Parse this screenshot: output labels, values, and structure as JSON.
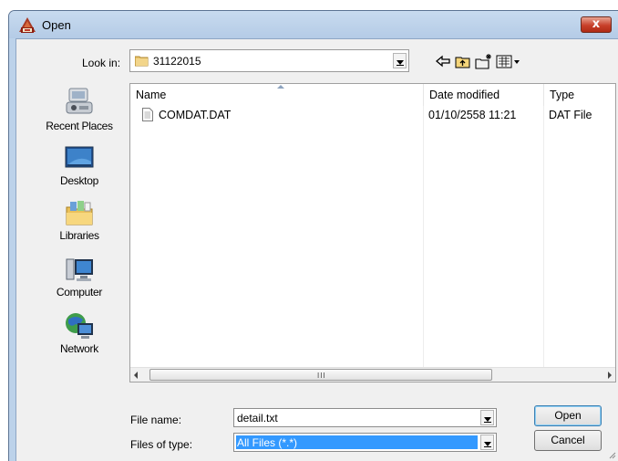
{
  "window": {
    "title": "Open",
    "close_label": "x"
  },
  "lookin": {
    "label": "Look in:",
    "value": "31122015"
  },
  "toolbar": {
    "back_icon": "back-arrow-icon",
    "up_icon": "up-folder-icon",
    "new_folder_icon": "new-folder-icon",
    "view_icon": "view-menu-icon"
  },
  "places": [
    {
      "label": "Recent Places",
      "icon": "recent-places-icon"
    },
    {
      "label": "Desktop",
      "icon": "desktop-icon"
    },
    {
      "label": "Libraries",
      "icon": "libraries-icon"
    },
    {
      "label": "Computer",
      "icon": "computer-icon"
    },
    {
      "label": "Network",
      "icon": "network-icon"
    }
  ],
  "filelist": {
    "columns": [
      "Name",
      "Date modified",
      "Type"
    ],
    "rows": [
      {
        "name": "COMDAT.DAT",
        "date": "01/10/2558 11:21",
        "type": "DAT File"
      }
    ],
    "scroll_grip": "III"
  },
  "filename": {
    "label": "File name:",
    "value": "detail.txt"
  },
  "filetype": {
    "label": "Files of type:",
    "value": "All Files (*.*)"
  },
  "buttons": {
    "open": "Open",
    "cancel": "Cancel"
  }
}
